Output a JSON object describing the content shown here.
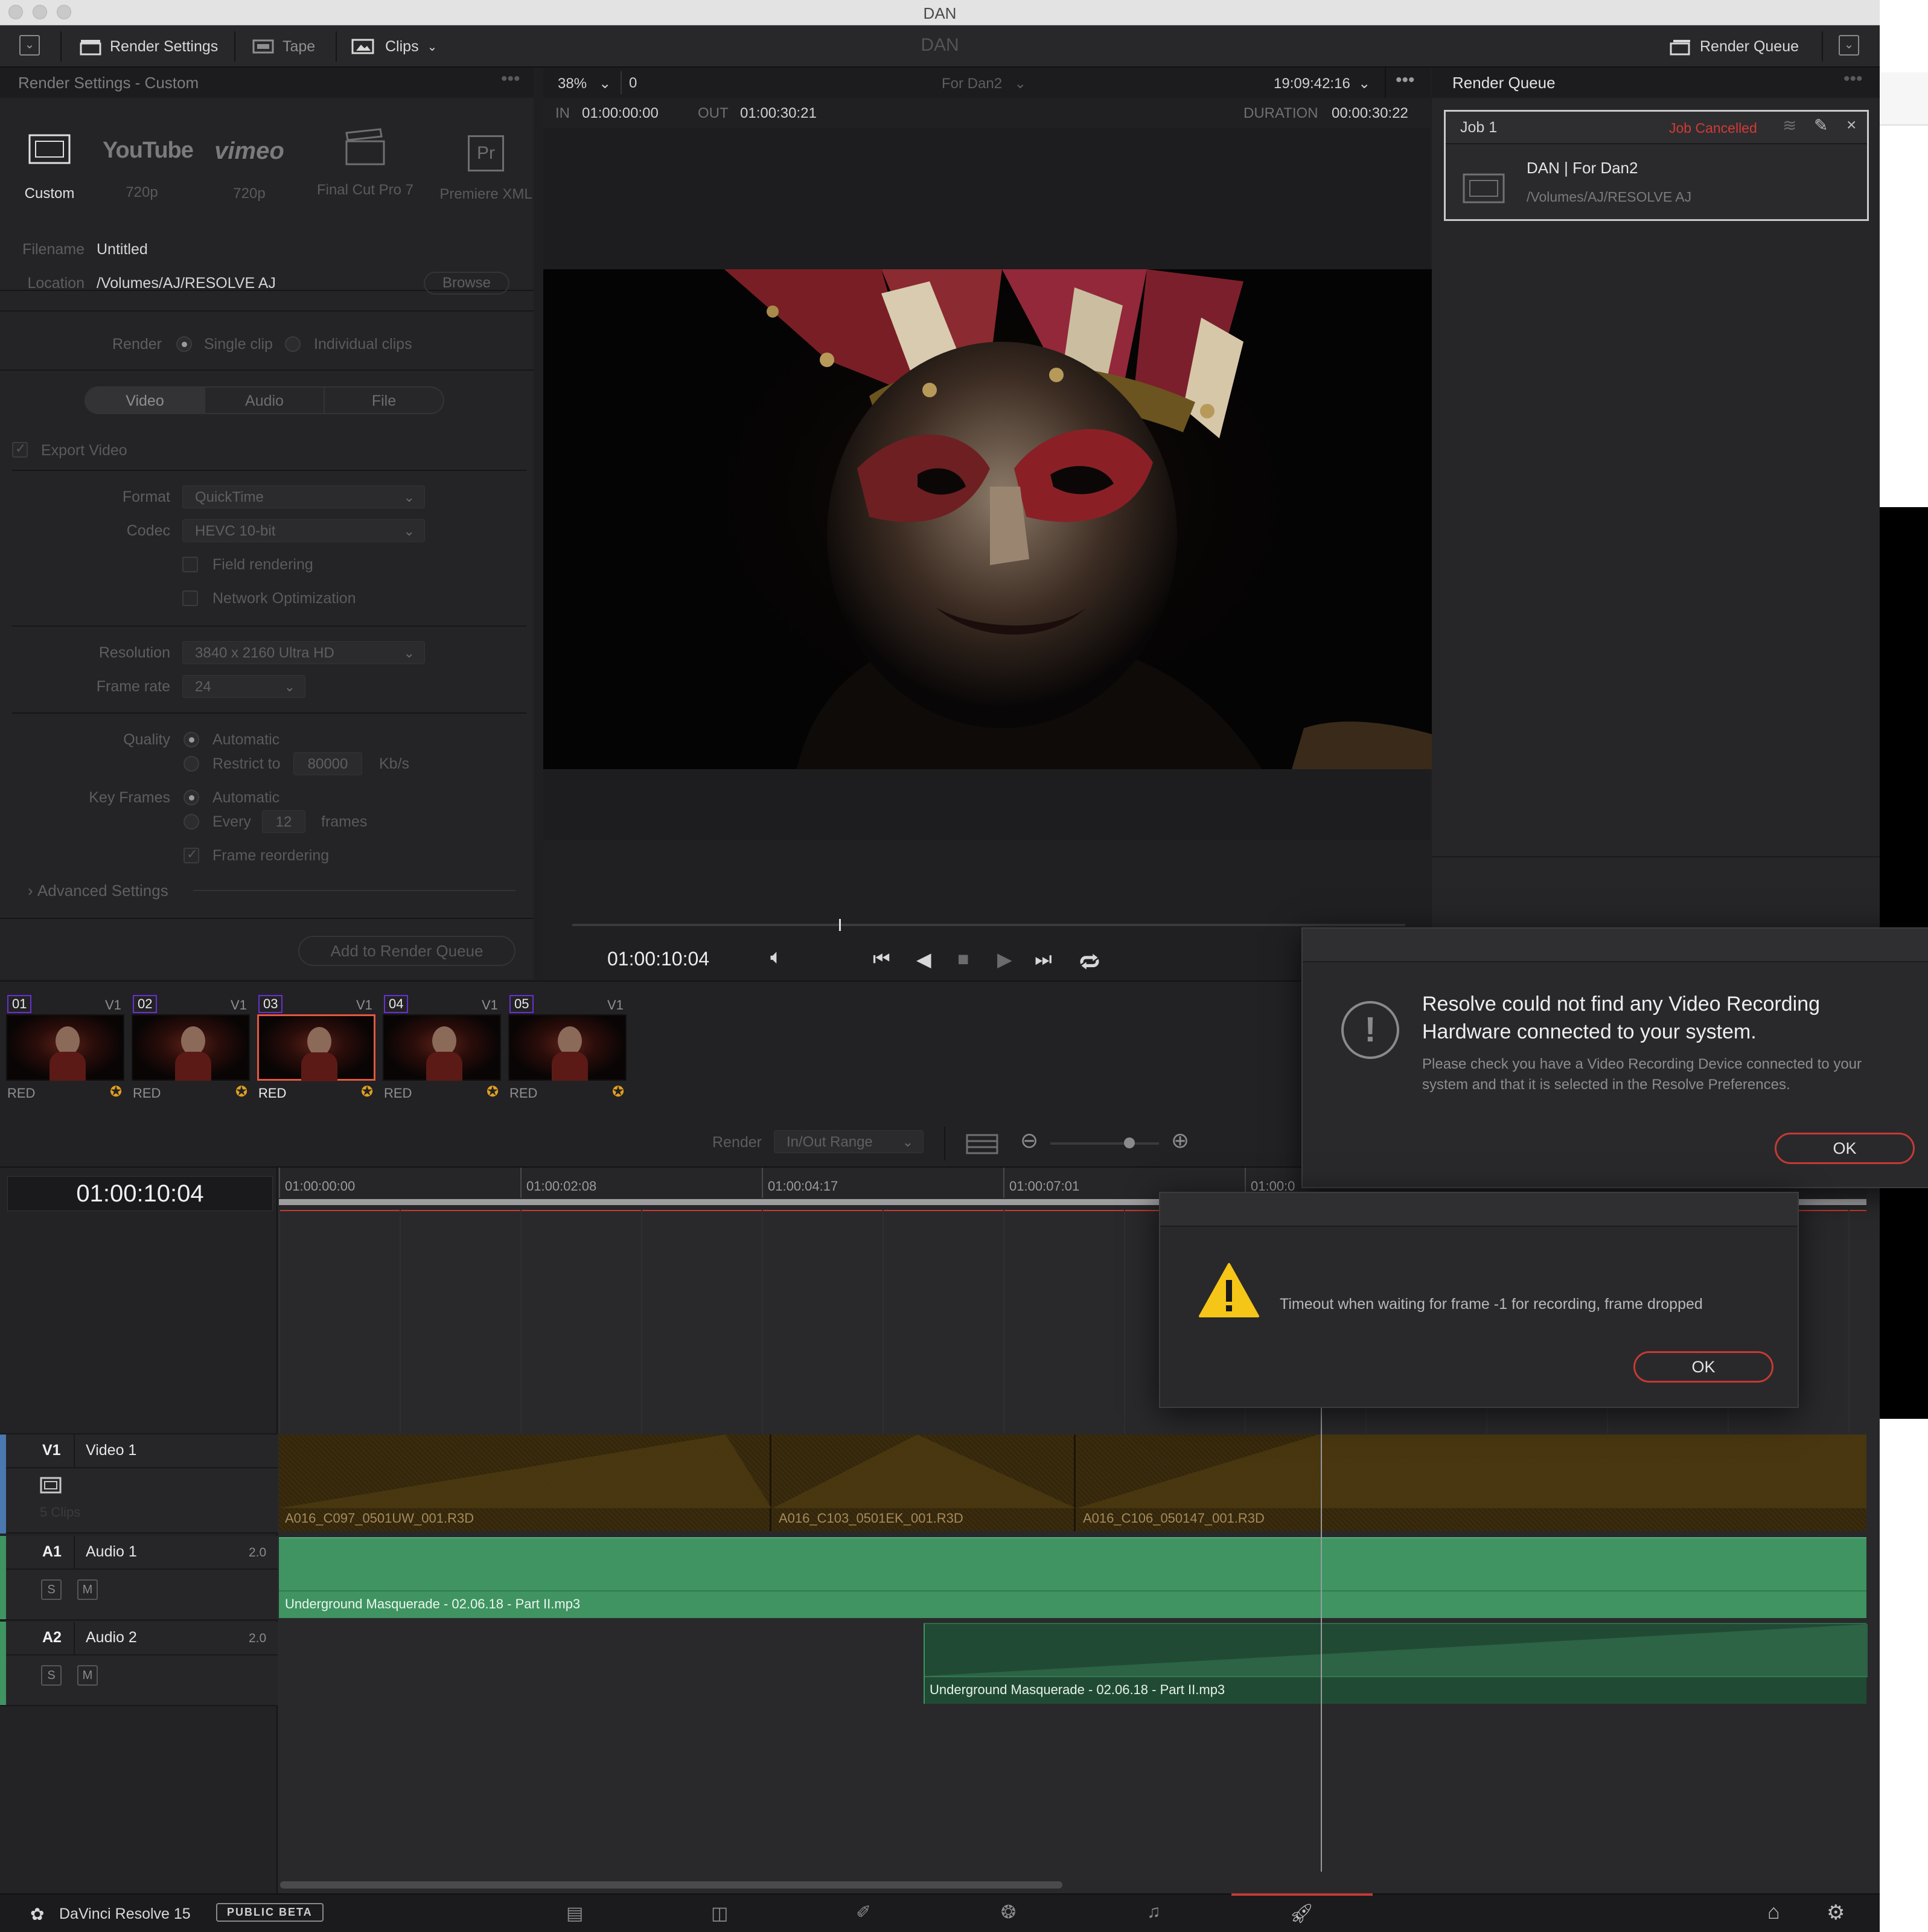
{
  "window": {
    "title": "DAN"
  },
  "header": {
    "render_settings": "Render Settings",
    "tape": "Tape",
    "clips": "Clips",
    "project": "DAN",
    "render_queue": "Render Queue"
  },
  "render_settings": {
    "title": "Render Settings - Custom",
    "presets": [
      {
        "name": "Custom",
        "sub": "",
        "icon": "film-frame-icon"
      },
      {
        "name": "YouTube",
        "sub": "720p",
        "icon": "youtube-logo"
      },
      {
        "name": "vimeo",
        "sub": "720p",
        "icon": "vimeo-logo"
      },
      {
        "name": "",
        "sub": "Final Cut Pro 7",
        "icon": "clapperboard-icon"
      },
      {
        "name": "Pr",
        "sub": "Premiere XML",
        "icon": "premiere-icon"
      }
    ],
    "filename_label": "Filename",
    "filename": "Untitled",
    "location_label": "Location",
    "location": "/Volumes/AJ/RESOLVE AJ",
    "browse": "Browse",
    "render_label": "Render",
    "single_clip": "Single clip",
    "individual_clips": "Individual clips",
    "tabs": [
      "Video",
      "Audio",
      "File"
    ],
    "export_video": "Export Video",
    "format_label": "Format",
    "format": "QuickTime",
    "codec_label": "Codec",
    "codec": "HEVC 10-bit",
    "field_rendering": "Field rendering",
    "network_optimization": "Network Optimization",
    "resolution_label": "Resolution",
    "resolution": "3840 x 2160 Ultra HD",
    "framerate_label": "Frame rate",
    "framerate": "24",
    "quality_label": "Quality",
    "quality_auto": "Automatic",
    "restrict_to": "Restrict to",
    "restrict_value": "80000",
    "kbs": "Kb/s",
    "keyframes_label": "Key Frames",
    "keyframes_auto": "Automatic",
    "every": "Every",
    "every_value": "12",
    "frames": "frames",
    "frame_reordering": "Frame reordering",
    "advanced": "Advanced Settings",
    "add_to_queue": "Add to Render Queue"
  },
  "viewer": {
    "zoom": "38%",
    "zero": "0",
    "timeline_name": "For Dan2",
    "timecode": "19:09:42:16",
    "in_label": "IN",
    "in": "01:00:00:00",
    "out_label": "OUT",
    "out": "01:00:30:21",
    "duration_label": "DURATION",
    "duration": "00:00:30:22",
    "current_time": "01:00:10:04",
    "playhead_position": 0.32
  },
  "render_queue": {
    "title": "Render Queue",
    "job": "Job 1",
    "status": "Job Cancelled",
    "status_color": "#d23a35",
    "job_title": "DAN | For Dan2",
    "job_path": "/Volumes/AJ/RESOLVE AJ"
  },
  "clips": [
    {
      "num": "01",
      "track": "V1",
      "codec": "RED",
      "color": "#6a2fd1"
    },
    {
      "num": "02",
      "track": "V1",
      "codec": "RED",
      "color": "#6a2fd1"
    },
    {
      "num": "03",
      "track": "V1",
      "codec": "RED",
      "color": "#6a2fd1"
    },
    {
      "num": "04",
      "track": "V1",
      "codec": "RED",
      "color": "#6a2fd1"
    },
    {
      "num": "05",
      "track": "V1",
      "codec": "RED",
      "color": "#6a2fd1"
    }
  ],
  "timeline": {
    "render_label": "Render",
    "render_mode": "In/Out Range",
    "timecode": "01:00:10:04",
    "ruler": [
      "01:00:00:00",
      "01:00:02:08",
      "01:00:04:17",
      "01:00:07:01",
      "01:00:0"
    ],
    "tracks": {
      "v1": {
        "id": "V1",
        "name": "Video 1",
        "count": "5 Clips"
      },
      "a1": {
        "id": "A1",
        "name": "Audio 1",
        "level": "2.0"
      },
      "a2": {
        "id": "A2",
        "name": "Audio 2",
        "level": "2.0"
      }
    },
    "video_clips": [
      "A016_C097_0501UW_001.R3D",
      "A016_C103_0501EK_001.R3D",
      "A016_C106_050147_001.R3D"
    ],
    "audio_clip": "Underground Masquerade - 02.06.18 - Part II.mp3",
    "solo": "S",
    "mute": "M"
  },
  "dialog_hw": {
    "title": "Resolve could not find any Video Recording Hardware connected to your system.",
    "body": "Please check you have a Video Recording Device connected to your system and that it is selected in the Resolve Preferences.",
    "ok": "OK"
  },
  "dialog_timeout": {
    "message": "Timeout when waiting for frame -1 for recording, frame dropped",
    "ok": "OK"
  },
  "bottom": {
    "app": "DaVinci Resolve 15",
    "badge": "PUBLIC BETA"
  },
  "colors": {
    "accent": "#c53a34",
    "audio_clip": "#3f9462",
    "video_clip": "#3a2b0e",
    "selected_clip": "#e2573f"
  }
}
